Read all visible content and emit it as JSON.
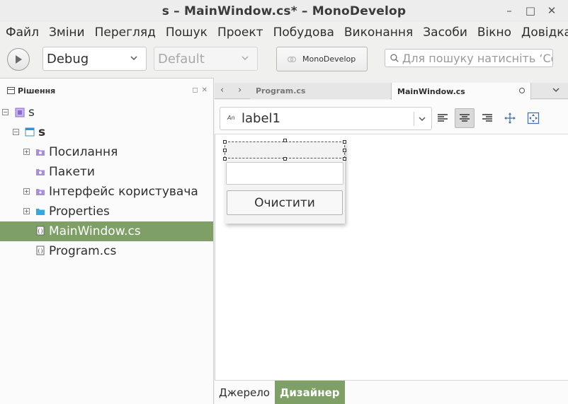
{
  "window": {
    "title": "s – MainWindow.cs* – MonoDevelop",
    "minimize": "–",
    "maximize": "□",
    "close": "✕"
  },
  "menu": [
    "Файл",
    "Зміни",
    "Перегляд",
    "Пошук",
    "Проект",
    "Побудова",
    "Виконання",
    "Засоби",
    "Вікно",
    "Довідка"
  ],
  "toolbar": {
    "configuration": "Debug",
    "target": "Default",
    "status_text": "MonoDevelop",
    "search_placeholder": "Для пошуку натисніть ‘Control+,’"
  },
  "solution_panel": {
    "title": "Рішення",
    "items": [
      {
        "label": "s",
        "icon": "solution-icon"
      },
      {
        "label": "s",
        "icon": "project-icon"
      },
      {
        "label": "Посилання",
        "icon": "references-folder-icon"
      },
      {
        "label": "Пакети",
        "icon": "packages-folder-icon"
      },
      {
        "label": "Інтерфейс користувача",
        "icon": "gui-folder-icon"
      },
      {
        "label": "Properties",
        "icon": "folder-icon"
      },
      {
        "label": "MainWindow.cs",
        "icon": "cs-file-icon",
        "selected": true
      },
      {
        "label": "Program.cs",
        "icon": "cs-file-icon"
      }
    ]
  },
  "editor": {
    "tabs": [
      {
        "label": "Program.cs",
        "active": false
      },
      {
        "label": "MainWindow.cs",
        "active": true
      }
    ],
    "widget_selector": {
      "prefix": "An",
      "value": "label1"
    },
    "preview": {
      "button_label": "Очистити"
    },
    "bottom_tabs": [
      {
        "label": "Джерело",
        "active": false
      },
      {
        "label": "Дизайнер",
        "active": true
      }
    ]
  },
  "colors": {
    "selection": "#7ea066",
    "accent_purple": "#9b7fd0",
    "folder_blue": "#36a8e0"
  }
}
